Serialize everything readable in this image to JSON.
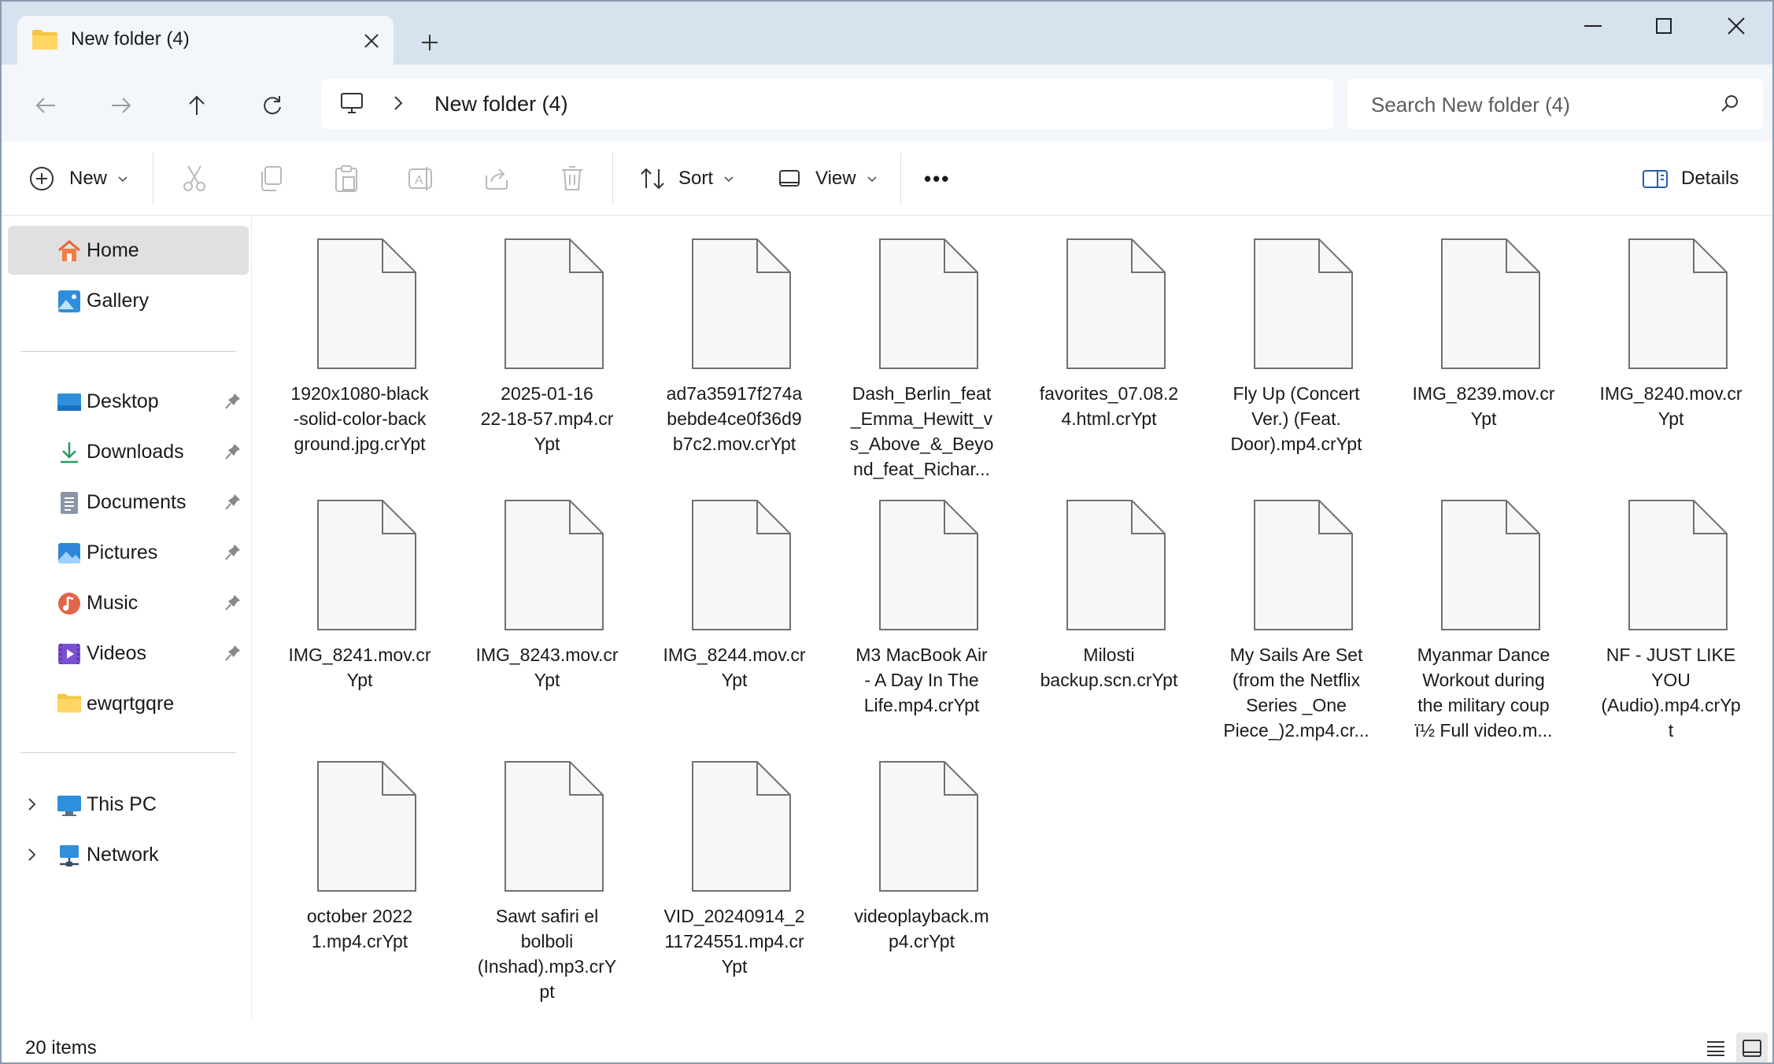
{
  "window": {
    "tab_title": "New folder (4)",
    "new_tab": "+"
  },
  "address": {
    "breadcrumb": "New folder (4)",
    "search_placeholder": "Search New folder (4)"
  },
  "toolbar": {
    "new_label": "New",
    "sort_label": "Sort",
    "view_label": "View",
    "more_label": "•••",
    "details_label": "Details"
  },
  "sidebar": {
    "home": "Home",
    "gallery": "Gallery",
    "pinned": [
      {
        "label": "Desktop",
        "icon": "desktop-icon"
      },
      {
        "label": "Downloads",
        "icon": "download-icon"
      },
      {
        "label": "Documents",
        "icon": "documents-icon"
      },
      {
        "label": "Pictures",
        "icon": "pictures-icon"
      },
      {
        "label": "Music",
        "icon": "music-icon"
      },
      {
        "label": "Videos",
        "icon": "videos-icon"
      }
    ],
    "folder": "ewqrtgqre",
    "this_pc": "This PC",
    "network": "Network"
  },
  "files": [
    "1920x1080-black\n-solid-color-back\nground.jpg.crYpt",
    "2025-01-16\n22-18-57.mp4.cr\nYpt",
    "ad7a35917f274a\nbebde4ce0f36d9\nb7c2.mov.crYpt",
    "Dash_Berlin_feat\n_Emma_Hewitt_v\ns_Above_&_Beyo\nnd_feat_Richar...",
    "favorites_07.08.2\n4.html.crYpt",
    "Fly Up (Concert\nVer.) (Feat.\nDoor).mp4.crYpt",
    "IMG_8239.mov.cr\nYpt",
    "IMG_8240.mov.cr\nYpt",
    "IMG_8241.mov.cr\nYpt",
    "IMG_8243.mov.cr\nYpt",
    "IMG_8244.mov.cr\nYpt",
    "M3 MacBook Air\n- A Day In The\nLife.mp4.crYpt",
    "Milosti\nbackup.scn.crYpt",
    "My Sails Are Set\n(from the Netflix\nSeries _One\nPiece_)2.mp4.cr...",
    "Myanmar Dance\nWorkout during\nthe military coup\nï½ Full video.m...",
    "NF - JUST LIKE\nYOU\n(Audio).mp4.crYp\nt",
    "october 2022\n1.mp4.crYpt",
    "Sawt safiri el\nbolboli\n(Inshad).mp3.crY\npt",
    "VID_20240914_2\n11724551.mp4.cr\nYpt",
    "videoplayback.m\np4.crYpt"
  ],
  "status": {
    "item_count": "20 items"
  }
}
